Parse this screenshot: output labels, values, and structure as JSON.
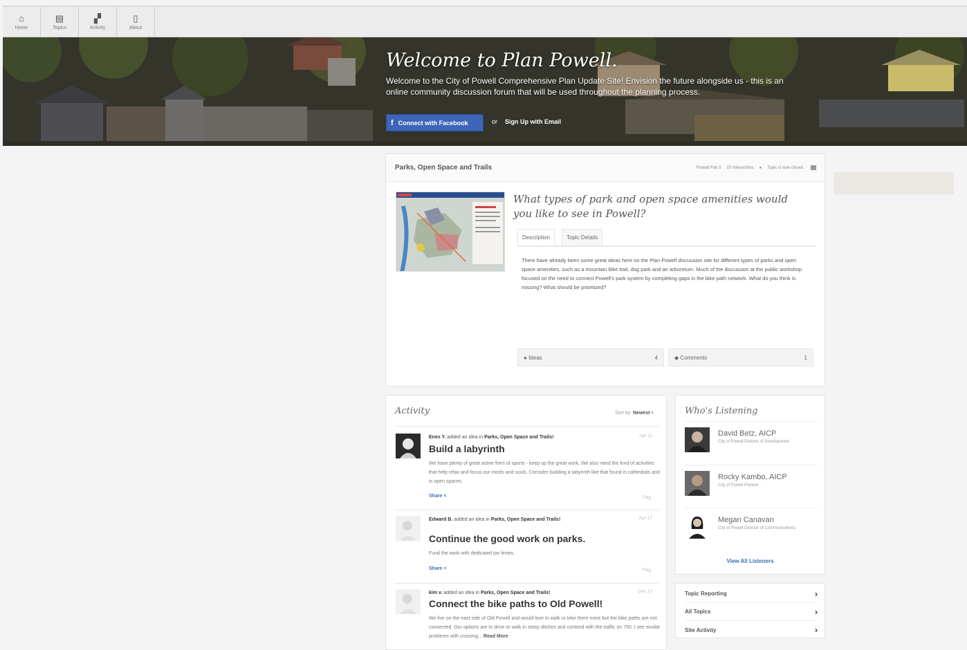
{
  "nav": [
    {
      "label": "Home",
      "icon": "home-icon",
      "glyph": "⌂"
    },
    {
      "label": "Topics",
      "icon": "topics-icon",
      "glyph": "▤"
    },
    {
      "label": "Activity",
      "icon": "activity-icon",
      "glyph": "▞"
    },
    {
      "label": "About",
      "icon": "about-icon",
      "glyph": "▯"
    }
  ],
  "hero": {
    "title": "Welcome to Plan Powell.",
    "subtitle": "Welcome to the City of Powell Comprehensive Plan Update Site! Envision the future alongside us - this is an online community discussion forum that will be used throughout the planning process.",
    "facebook_button": "Connect with Facebook",
    "or": "or",
    "email_link": "Sign Up with Email"
  },
  "topic": {
    "category": "Parks, Open Space and Trails",
    "posted": "Posted Feb 9",
    "interactions": "10 Interactions",
    "closed": "Topic is now closed",
    "question": "What types of park and open space amenities would you like to see in Powell?",
    "tabs": [
      "Description",
      "Topic Details"
    ],
    "description": "There have already been some great ideas here on the Plan Powell discussion site for different types of parks and open space amenities, such as a mountain bike trail, dog park and an arboretum. Much of the discussion at the public workshop focused on the need to connect Powell's park system by completing gaps in the bike path network. What do you think is missing? What should be prioritized?",
    "ideas_label": "Ideas",
    "ideas_count": "4",
    "comments_label": "Comments",
    "comments_count": "1"
  },
  "activity": {
    "title": "Activity",
    "sort_prefix": "Sort by:",
    "sort_value": "Newest",
    "items": [
      {
        "byline_user": "Enes Y.",
        "byline_rest": " added an idea in ",
        "byline_topic": "Parks, Open Space and Trails!",
        "date": "Apr 11",
        "title": "Build a labyrinth",
        "text": "We have plenty of great active form of sports - keep up the great work. We also need the kind of activities that help relax and focus our minds and souls. Consider building a labyrinth like that found in cathedrals and in open spaces.",
        "share": "Share",
        "flag": "Flag"
      },
      {
        "byline_user": "Edward B.",
        "byline_rest": " added an idea in ",
        "byline_topic": "Parks, Open Space and Trails!",
        "date": "Apr 17",
        "title": "Continue the good work on parks.",
        "text": "Fund the work with dedicated tax levies.",
        "share": "Share",
        "flag": "Flag"
      },
      {
        "byline_user": "kim v.",
        "byline_rest": " added an idea in ",
        "byline_topic": "Parks, Open Space and Trails!",
        "date": "Dec 17",
        "title": "Connect the bike paths to Old Powell!",
        "text": "We live on the east side of Old Powell and would love to walk or bike there more but the bike paths are not connected. Our options are to drive or walk in steep ditches and contend with the traffic on 750. I see similar problems with crossing...",
        "read_more": "Read More"
      }
    ]
  },
  "listening": {
    "title": "Who's Listening",
    "people": [
      {
        "name": "David Betz, AICP",
        "role": "City of Powell Director of Development"
      },
      {
        "name": "Rocky Kambo, AICP",
        "role": "City of Powell Planner"
      },
      {
        "name": "Megan Canavan",
        "role": "City of Powell Director of Communications"
      }
    ],
    "view_all": "View All Listeners"
  },
  "links": [
    "Topic Reporting",
    "All Topics",
    "Site Activity"
  ],
  "colors": {
    "facebook": "#3d65b8",
    "link": "#3b6fb0"
  }
}
